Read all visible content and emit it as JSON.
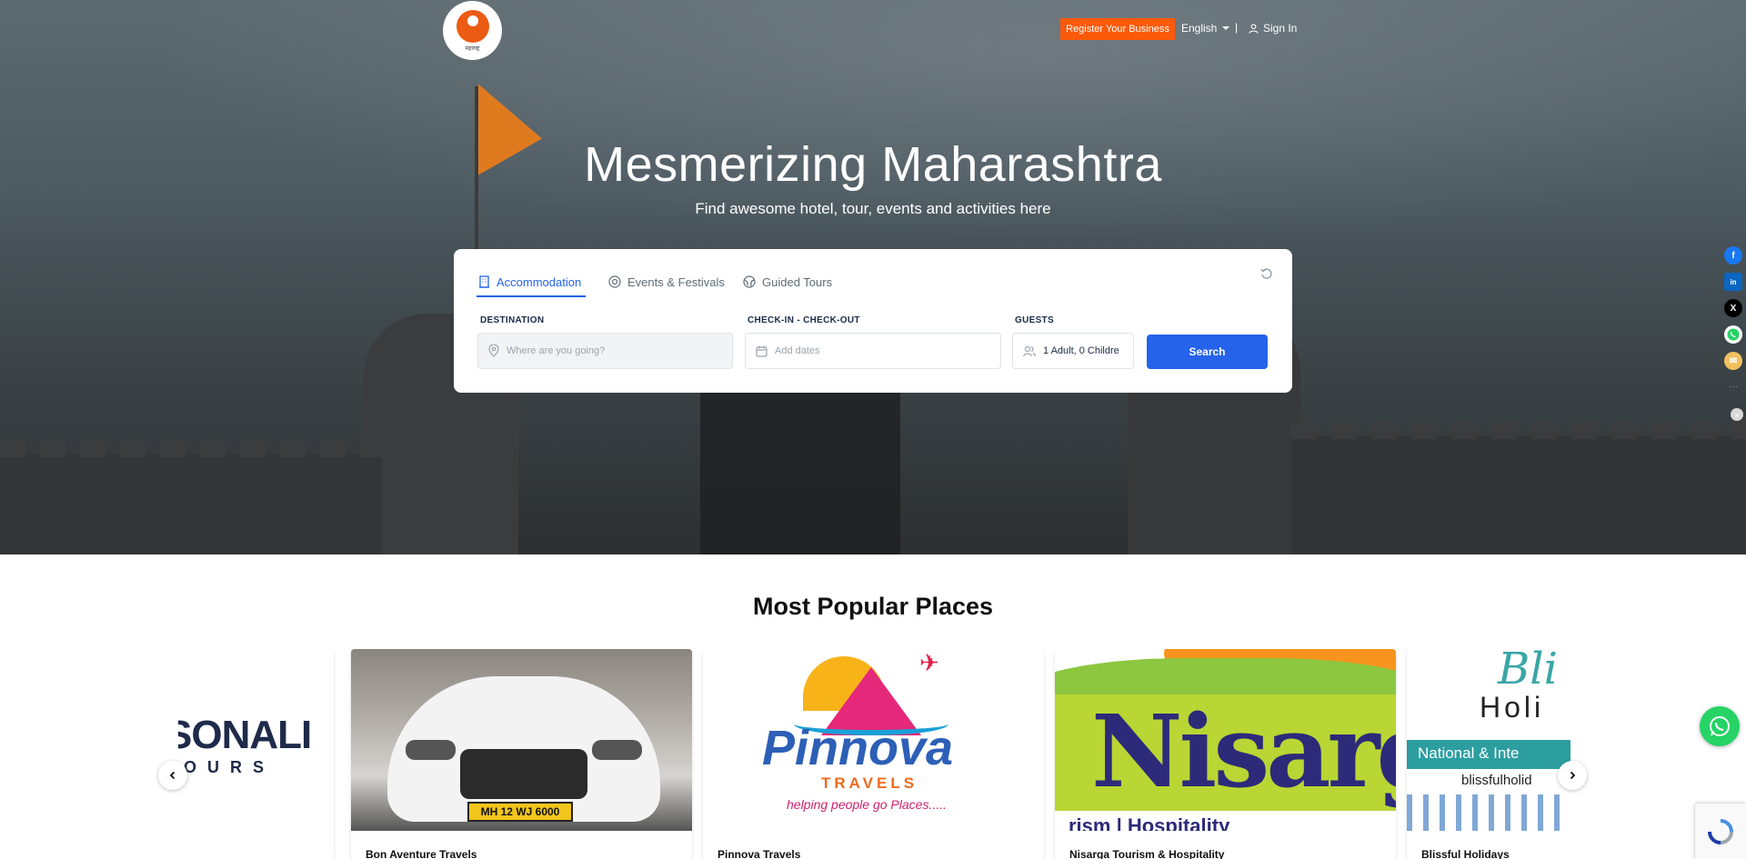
{
  "header": {
    "logo_text": "महाराष्ट्र",
    "register_label": "Register Your Business",
    "language": "English",
    "separator": "|",
    "signin_label": "Sign In"
  },
  "hero": {
    "title": "Mesmerizing Maharashtra",
    "subtitle": "Find awesome hotel, tour, events and activities here"
  },
  "search": {
    "tabs": [
      {
        "label": "Accommodation",
        "icon": "building-icon",
        "active": true
      },
      {
        "label": "Events & Festivals",
        "icon": "target-icon",
        "active": false
      },
      {
        "label": "Guided Tours",
        "icon": "globe-icon",
        "active": false
      }
    ],
    "destination_label": "DESTINATION",
    "destination_placeholder": "Where are you going?",
    "dates_label": "CHECK-IN - CHECK-OUT",
    "dates_placeholder": "Add dates",
    "guests_label": "GUESTS",
    "guests_value": "1 Adult, 0 Childre",
    "search_label": "Search"
  },
  "share": {
    "facebook": "f",
    "linkedin": "in",
    "x": "X",
    "whatsapp": "W",
    "email": "✉",
    "more": "···"
  },
  "popular": {
    "title": "Most Popular Places",
    "cards": [
      {
        "name": "",
        "logo_top": "SONALI",
        "logo_bottom": "OURS"
      },
      {
        "name": "Bon Aventure Travels",
        "plate": "MH 12 WJ 6000"
      },
      {
        "name": "Pinnova Travels",
        "logo_top": "Pinnova",
        "logo_sub": "TRAVELS",
        "tagline": "helping people go Places....."
      },
      {
        "name": "Nisarga Tourism & Hospitality",
        "logo_top": "Nisarg",
        "logo_sub": "rism | Hospitality"
      },
      {
        "name": "Blissful Holidays",
        "logo_top": "Bli",
        "logo_mid": "Holi",
        "logo_band": "National & Inte",
        "logo_sub": "blissfulholid"
      }
    ]
  },
  "colors": {
    "accent": "#2563eb",
    "brand_orange": "#fa5a0a",
    "whatsapp": "#25d366"
  }
}
